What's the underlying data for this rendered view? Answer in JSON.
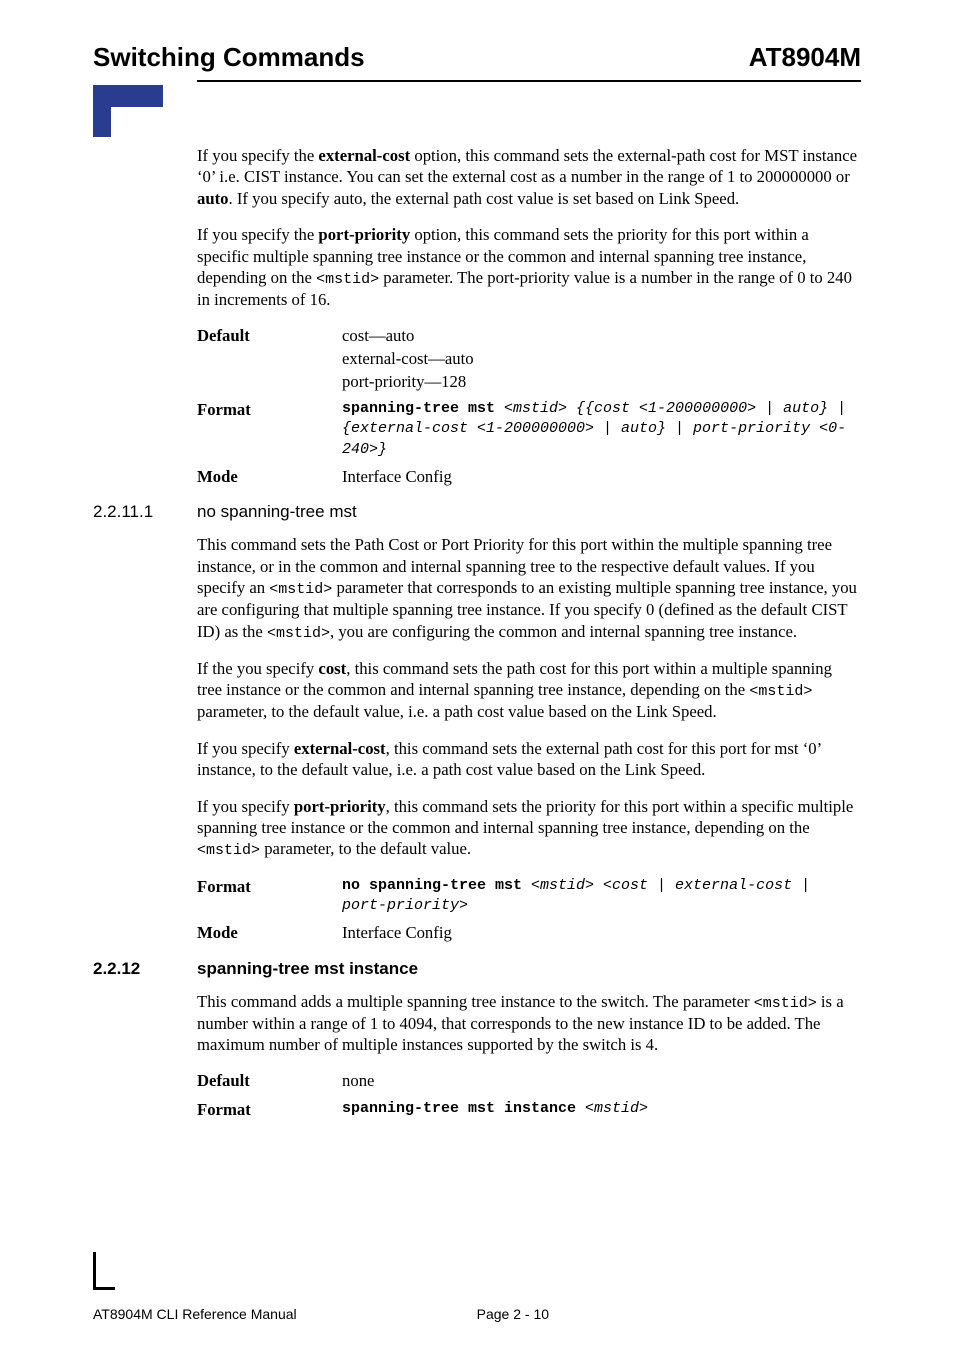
{
  "header": {
    "left": "Switching Commands",
    "right": "AT8904M"
  },
  "body": {
    "p1_a": "If you specify the ",
    "p1_b": "external-cost",
    "p1_c": " option, this command sets the external-path cost for MST instance ‘0’ i.e. CIST instance. You can set the external cost as a number in the range of 1 to 200000000 or ",
    "p1_d": "auto",
    "p1_e": ". If you specify auto, the external path cost value is set based on Link Speed.",
    "p2_a": "If you specify the ",
    "p2_b": "port-priority",
    "p2_c": " option, this command sets the priority for this port within a specific multiple spanning tree instance or the common and internal spanning tree instance, depending on the ",
    "p2_d": "<mstid>",
    "p2_e": " parameter. The port-priority value is a number in the range of 0 to 240 in increments of 16.",
    "dl1": {
      "default_label": "Default",
      "default_val_1": "cost—auto",
      "default_val_2": "external-cost—auto",
      "default_val_3": "port-priority—128",
      "format_label": "Format",
      "format_val_bold": "spanning-tree mst ",
      "format_val_ital1": "<mstid> {{cost <1-200000000> | auto} |",
      "format_val_ital2": "{external-cost <1-200000000> | auto} | port-priority <0-240>}",
      "mode_label": "Mode",
      "mode_val": "Interface Config"
    },
    "sec1": {
      "num": "2.2.11.1",
      "title": "no spanning-tree mst"
    },
    "p3_a": "This command sets the Path Cost or Port Priority for this port within the multiple spanning tree instance, or in the common and internal spanning tree to the respective default values. If you specify an ",
    "p3_b": "<mstid>",
    "p3_c": " parameter that corresponds to an existing multiple spanning tree instance, you are configuring that multiple spanning tree instance. If you specify 0 (defined as the default CIST ID) as the ",
    "p3_d": "<mstid>",
    "p3_e": ", you are configuring the common and internal spanning tree instance.",
    "p4_a": "If the you specify ",
    "p4_b": "cost",
    "p4_c": ", this command sets the path cost for this port within a multiple spanning tree instance or the common and internal spanning tree instance, depending on the ",
    "p4_d": "<mstid>",
    "p4_e": " parameter, to the default value, i.e. a path cost value based on the Link Speed.",
    "p5_a": "If you specify ",
    "p5_b": "external-cost",
    "p5_c": ", this command sets the external path cost for this port for mst ‘0’ instance, to the default value, i.e. a path cost value based on the Link Speed.",
    "p6_a": "If you specify ",
    "p6_b": "port-priority",
    "p6_c": ", this command sets the priority for this port within a specific multiple spanning tree instance or the common and internal spanning tree instance, depending on the ",
    "p6_d": "<mstid>",
    "p6_e": " parameter, to the default value.",
    "dl2": {
      "format_label": "Format",
      "format_val_bold": "no spanning-tree mst ",
      "format_val_ital": "<mstid> <cost | external-cost | port-priority>",
      "mode_label": "Mode",
      "mode_val": "Interface Config"
    },
    "sec2": {
      "num": "2.2.12",
      "title": "spanning-tree mst instance"
    },
    "p7_a": "This command adds a multiple spanning tree instance to the switch. The parameter ",
    "p7_b": "<mstid>",
    "p7_c": " is a number within a range of 1 to 4094, that corresponds to the new instance ID to be added. The maximum number of multiple instances supported by the switch is 4.",
    "dl3": {
      "default_label": "Default",
      "default_val": "none",
      "format_label": "Format",
      "format_val_bold": "spanning-tree mst instance ",
      "format_val_ital": "<mstid>"
    }
  },
  "footer": {
    "left": "AT8904M CLI Reference Manual",
    "right": "Page 2 - 10"
  }
}
